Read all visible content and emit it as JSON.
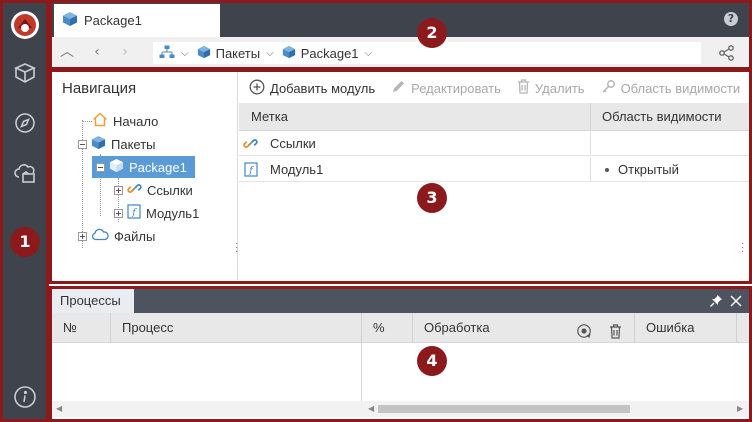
{
  "header": {
    "tab_title": "Package1",
    "breadcrumb": [
      {
        "label": "Пакеты"
      },
      {
        "label": "Package1"
      }
    ]
  },
  "navigation": {
    "title": "Навигация",
    "tree": {
      "home": "Начало",
      "packages": "Пакеты",
      "package1": "Package1",
      "links": "Ссылки",
      "module1": "Модуль1",
      "files": "Файлы"
    }
  },
  "toolbar": {
    "add_module": "Добавить модуль",
    "edit": "Редактировать",
    "delete": "Удалить",
    "visibility": "Область видимости"
  },
  "grid": {
    "columns": {
      "label": "Метка",
      "visibility": "Область видимости"
    },
    "rows": [
      {
        "label": "Ссылки",
        "visibility": ""
      },
      {
        "label": "Модуль1",
        "visibility": "Открытый"
      }
    ]
  },
  "processes": {
    "tab_title": "Процессы",
    "columns": {
      "number": "№",
      "process": "Процесс",
      "percent": "%",
      "handling": "Обработка",
      "error": "Ошибка"
    }
  },
  "callouts": [
    "1",
    "2",
    "3",
    "4"
  ],
  "colors": {
    "sidebar_bg": "#3f434c",
    "accent": "#5b9bd5",
    "annotation": "#8c1a1d",
    "selection": "#5b9bd5"
  },
  "icons": {
    "sidebar": [
      "app-logo-icon",
      "cube-icon",
      "compass-icon",
      "cloud-folder-icon",
      "info-icon"
    ],
    "tree": [
      "home-icon",
      "package-icon",
      "package-icon",
      "link-icon",
      "module-icon",
      "cloud-icon"
    ]
  }
}
